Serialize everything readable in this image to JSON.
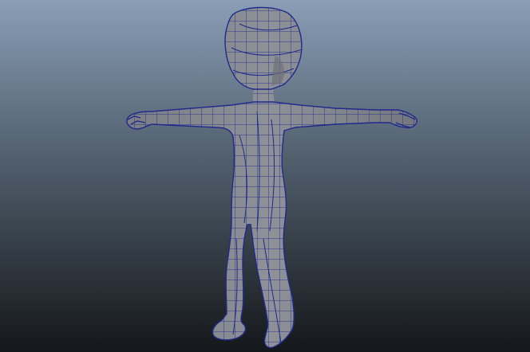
{
  "viewport": {
    "background_top": "#8a9eb6",
    "background_mid": "#4b5865",
    "background_bottom": "#14171a"
  },
  "model": {
    "surface_color": "#8a8d92",
    "shadow_color": "#6e7177",
    "wire_color": "#1f2a8c",
    "icon": "t-pose-character-mesh"
  }
}
